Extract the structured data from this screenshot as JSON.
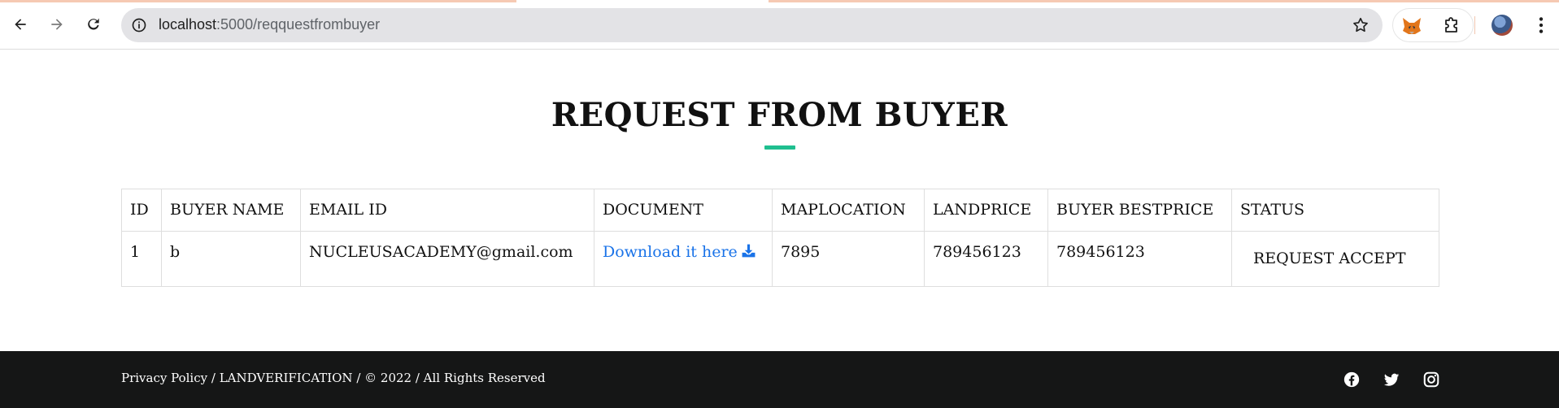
{
  "browser": {
    "url_host": "localhost",
    "url_path": ":5000/reqquestfrombuyer",
    "icons": {
      "back": "arrow-left-icon",
      "forward": "arrow-right-icon",
      "reload": "reload-icon",
      "site_info": "info-icon",
      "bookmark": "star-icon",
      "extension_1": "fox-icon",
      "extensions": "puzzle-icon",
      "profile": "avatar",
      "menu": "kebab-icon"
    }
  },
  "page": {
    "title": "REQUEST FROM BUYER",
    "accent_color": "#1fbf8f"
  },
  "table": {
    "headers": [
      "ID",
      "BUYER NAME",
      "EMAIL ID",
      "DOCUMENT",
      "MAPLOCATION",
      "LANDPRICE",
      "BUYER BESTPRICE",
      "STATUS"
    ],
    "rows": [
      {
        "id": "1",
        "buyer_name": "b",
        "email": "NUCLEUSACADEMY@gmail.com",
        "document_link": "Download it here",
        "maplocation": "7895",
        "landprice": "789456123",
        "buyer_bestprice": "789456123",
        "status_button": "REQUEST ACCEPT"
      }
    ]
  },
  "footer": {
    "text": "Privacy Policy / LANDVERIFICATION / © 2022 / All Rights Reserved",
    "social": [
      "facebook-icon",
      "twitter-icon",
      "instagram-icon"
    ],
    "background": "#151616"
  }
}
